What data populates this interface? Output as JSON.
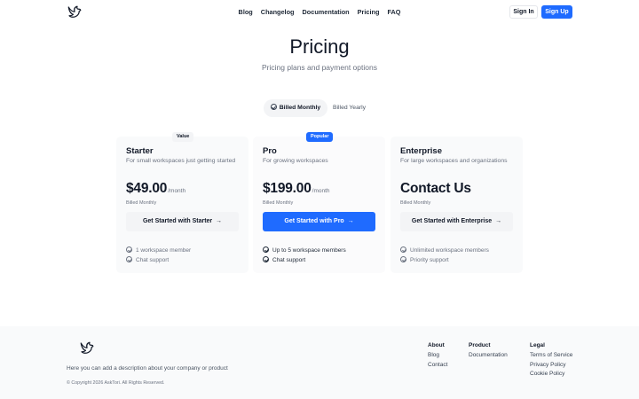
{
  "header": {
    "logo_icon": "bird-icon",
    "nav": [
      "Blog",
      "Changelog",
      "Documentation",
      "Pricing",
      "FAQ"
    ],
    "sign_in": "Sign In",
    "sign_up": "Sign Up"
  },
  "hero": {
    "title": "Pricing",
    "subtitle": "Pricing plans and payment options"
  },
  "toggle": {
    "monthly": "Billed Monthly",
    "yearly": "Billed Yearly"
  },
  "plans": [
    {
      "badge": "Value",
      "name": "Starter",
      "description": "For small workspaces just getting started",
      "price": "$49.00",
      "period": "/month",
      "billed": "Billed Monthly",
      "cta": "Get Started with Starter",
      "features": [
        "1 workspace member",
        "Chat support"
      ]
    },
    {
      "badge": "Popular",
      "name": "Pro",
      "description": "For growing workspaces",
      "price": "$199.00",
      "period": "/month",
      "billed": "Billed Monthly",
      "cta": "Get Started with Pro",
      "features": [
        "Up to 5 workspace members",
        "Chat support"
      ]
    },
    {
      "name": "Enterprise",
      "description": "For large workspaces and organizations",
      "price": "Contact Us",
      "billed": "Billed Monthly",
      "cta": "Get Started with Enterprise",
      "features": [
        "Unlimited workspace members",
        "Priority support"
      ]
    }
  ],
  "footer": {
    "description": "Here you can add a description about your company or product",
    "copyright": "© Copyright 2026 AskTori. All Rights Reserved.",
    "columns": [
      {
        "heading": "About",
        "links": [
          "Blog",
          "Contact"
        ]
      },
      {
        "heading": "Product",
        "links": [
          "Documentation"
        ]
      },
      {
        "heading": "Legal",
        "links": [
          "Terms of Service",
          "Privacy Policy",
          "Cookie Policy"
        ]
      }
    ]
  },
  "colors": {
    "primary": "#1f6bff",
    "muted_text": "#6b7280",
    "card_bg": "#f9fafb"
  }
}
